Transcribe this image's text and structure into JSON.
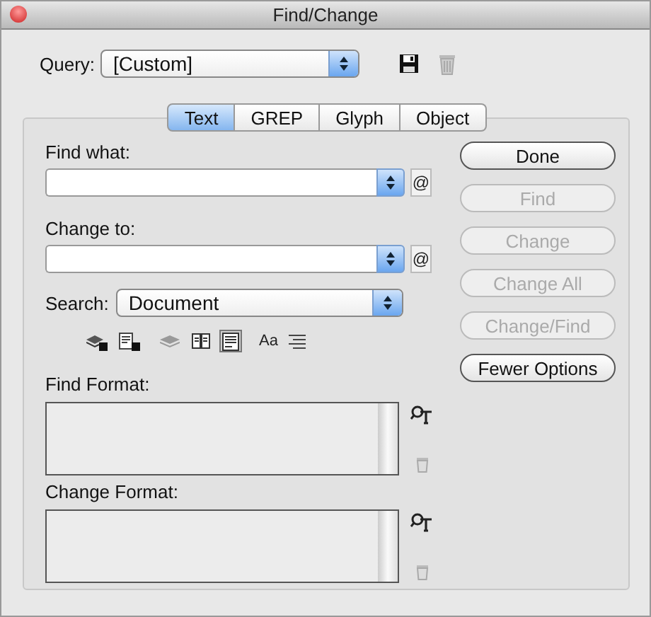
{
  "window": {
    "title": "Find/Change"
  },
  "query": {
    "label": "Query:",
    "value": "[Custom]"
  },
  "tabs": [
    {
      "label": "Text",
      "selected": true
    },
    {
      "label": "GREP",
      "selected": false
    },
    {
      "label": "Glyph",
      "selected": false
    },
    {
      "label": "Object",
      "selected": false
    }
  ],
  "find_what": {
    "label": "Find what:",
    "at_symbol": "@"
  },
  "change_to": {
    "label": "Change to:",
    "at_symbol": "@"
  },
  "search": {
    "label": "Search:",
    "value": "Document"
  },
  "search_options": [
    {
      "kind": "locked-layers",
      "on": false
    },
    {
      "kind": "locked-stories",
      "on": false
    },
    {
      "kind": "hidden-layers",
      "on": false
    },
    {
      "kind": "master-pages",
      "on": false
    },
    {
      "kind": "footnotes",
      "on": true
    },
    {
      "kind": "case",
      "label": "Aa",
      "on": false
    },
    {
      "kind": "whole-word",
      "on": false
    }
  ],
  "find_format": {
    "label": "Find Format:"
  },
  "change_format": {
    "label": "Change Format:"
  },
  "buttons": [
    {
      "label": "Done",
      "disabled": false
    },
    {
      "label": "Find",
      "disabled": true
    },
    {
      "label": "Change",
      "disabled": true
    },
    {
      "label": "Change All",
      "disabled": true
    },
    {
      "label": "Change/Find",
      "disabled": true
    },
    {
      "label": "Fewer Options",
      "disabled": false
    }
  ]
}
